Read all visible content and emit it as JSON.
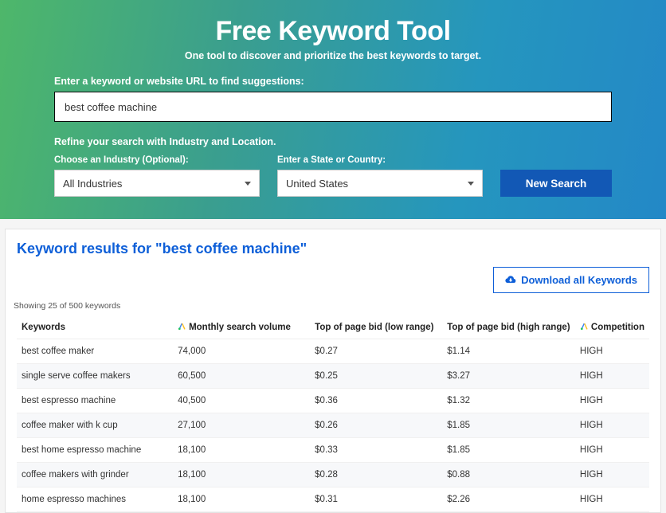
{
  "hero": {
    "title": "Free Keyword Tool",
    "subtitle": "One tool to discover and prioritize the best keywords to target.",
    "search_label": "Enter a keyword or website URL to find suggestions:",
    "search_value": "best coffee machine",
    "refine_label": "Refine your search with Industry and Location.",
    "industry_label": "Choose an Industry (Optional):",
    "industry_value": "All Industries",
    "location_label": "Enter a State or Country:",
    "location_value": "United States",
    "search_button": "New Search"
  },
  "results": {
    "title": "Keyword results for \"best coffee machine\"",
    "download_label": "Download all Keywords",
    "count_label": "Showing 25 of 500 keywords",
    "columns": {
      "keywords": "Keywords",
      "volume": "Monthly search volume",
      "bid_low": "Top of page bid (low range)",
      "bid_high": "Top of page bid (high range)",
      "competition": "Competition"
    },
    "rows": [
      {
        "kw": "best coffee maker",
        "vol": "74,000",
        "low": "$0.27",
        "high": "$1.14",
        "comp": "HIGH"
      },
      {
        "kw": "single serve coffee makers",
        "vol": "60,500",
        "low": "$0.25",
        "high": "$3.27",
        "comp": "HIGH"
      },
      {
        "kw": "best espresso machine",
        "vol": "40,500",
        "low": "$0.36",
        "high": "$1.32",
        "comp": "HIGH"
      },
      {
        "kw": "coffee maker with k cup",
        "vol": "27,100",
        "low": "$0.26",
        "high": "$1.85",
        "comp": "HIGH"
      },
      {
        "kw": "best home espresso machine",
        "vol": "18,100",
        "low": "$0.33",
        "high": "$1.85",
        "comp": "HIGH"
      },
      {
        "kw": "coffee makers with grinder",
        "vol": "18,100",
        "low": "$0.28",
        "high": "$0.88",
        "comp": "HIGH"
      },
      {
        "kw": "home espresso machines",
        "vol": "18,100",
        "low": "$0.31",
        "high": "$2.26",
        "comp": "HIGH"
      }
    ]
  }
}
